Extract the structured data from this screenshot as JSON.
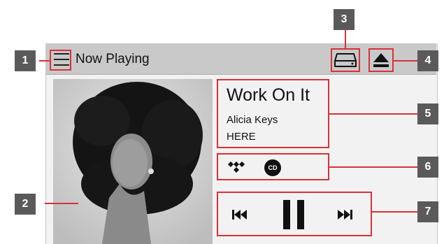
{
  "header": {
    "title": "Now Playing",
    "menu_icon": "hamburger-menu-icon",
    "drive_icon": "hard-drive-icon",
    "eject_icon": "eject-icon"
  },
  "now_playing": {
    "album_art_icon": "album-cover-portrait",
    "track_title": "Work On It",
    "artist": "Alicia Keys",
    "album": "HERE"
  },
  "source": {
    "service_icon": "tidal-icon",
    "cd_label": "CD"
  },
  "controls": {
    "prev_icon": "skip-previous-icon",
    "pause_icon": "pause-icon",
    "next_icon": "skip-next-icon"
  },
  "callouts": {
    "c1": "1",
    "c2": "2",
    "c3": "3",
    "c4": "4",
    "c5": "5",
    "c6": "6",
    "c7": "7"
  },
  "colors": {
    "callout_red": "#d6323a",
    "badge_gray": "#5a5a5a",
    "topbar_gray": "#c9c9c9"
  }
}
